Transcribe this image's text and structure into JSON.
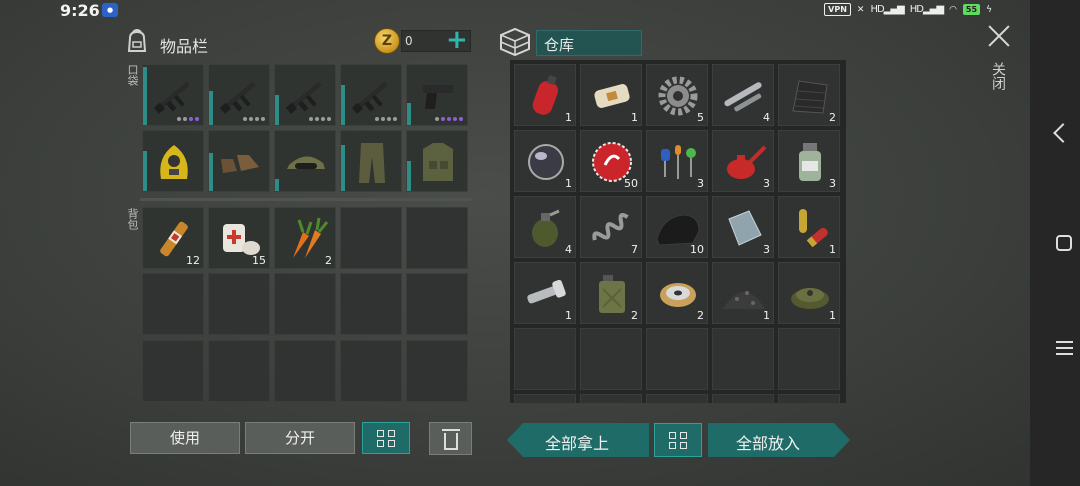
{
  "status_bar": {
    "time": "9:26",
    "vpn": "VPN",
    "network1": "HD",
    "network2": "HD",
    "battery": "55"
  },
  "inventory": {
    "title": "物品栏",
    "coins": "0",
    "pocket_label": "口袋",
    "backpack_label": "背包"
  },
  "storage": {
    "title": "仓库"
  },
  "close_label": "关闭",
  "equipped": [
    {
      "icon": "assault-rifle-icon",
      "dots": [
        "g",
        "g",
        "p",
        "p"
      ]
    },
    {
      "icon": "assault-rifle-icon",
      "dots": [
        "g",
        "g",
        "g",
        "g"
      ]
    },
    {
      "icon": "assault-rifle-icon",
      "dots": [
        "g",
        "g",
        "g",
        "g"
      ]
    },
    {
      "icon": "assault-rifle-icon",
      "dots": [
        "g",
        "g",
        "g",
        "g"
      ]
    },
    {
      "icon": "pistol-icon",
      "dots": [
        "g",
        "p",
        "p",
        "p",
        "p"
      ]
    },
    {
      "icon": "hazmat-hood-icon"
    },
    {
      "icon": "boots-icon"
    },
    {
      "icon": "cap-goggles-icon"
    },
    {
      "icon": "camo-pants-icon"
    },
    {
      "icon": "tactical-vest-icon"
    }
  ],
  "backpack": [
    {
      "icon": "ampoule-icon",
      "count": "12"
    },
    {
      "icon": "bandage-icon",
      "count": "15"
    },
    {
      "icon": "carrot-icon",
      "count": "2"
    }
  ],
  "storage_items": [
    {
      "icon": "gas-cylinder-icon",
      "count": "1"
    },
    {
      "icon": "soap-bar-icon",
      "count": "1"
    },
    {
      "icon": "gear-icon",
      "count": "5"
    },
    {
      "icon": "pipe-icon",
      "count": "4"
    },
    {
      "icon": "carbon-sheet-icon",
      "count": "2"
    },
    {
      "icon": "lens-icon",
      "count": "1"
    },
    {
      "icon": "bottle-cap-icon",
      "count": "50"
    },
    {
      "icon": "electronic-parts-icon",
      "count": "3"
    },
    {
      "icon": "oil-can-icon",
      "count": "3"
    },
    {
      "icon": "chemical-jar-icon",
      "count": "3"
    },
    {
      "icon": "grenade-icon",
      "count": "4"
    },
    {
      "icon": "spring-icon",
      "count": "7"
    },
    {
      "icon": "rubber-sheet-icon",
      "count": "10"
    },
    {
      "icon": "metal-plate-icon",
      "count": "3"
    },
    {
      "icon": "ammo-shell-icon",
      "count": "1"
    },
    {
      "icon": "flashlight-icon",
      "count": "1"
    },
    {
      "icon": "jerrycan-icon",
      "count": "2"
    },
    {
      "icon": "wire-spool-icon",
      "count": "2"
    },
    {
      "icon": "gravel-pile-icon",
      "count": "1"
    },
    {
      "icon": "landmine-icon",
      "count": "1"
    }
  ],
  "buttons": {
    "use": "使用",
    "split": "分开",
    "take_all": "全部拿上",
    "put_all": "全部放入"
  }
}
